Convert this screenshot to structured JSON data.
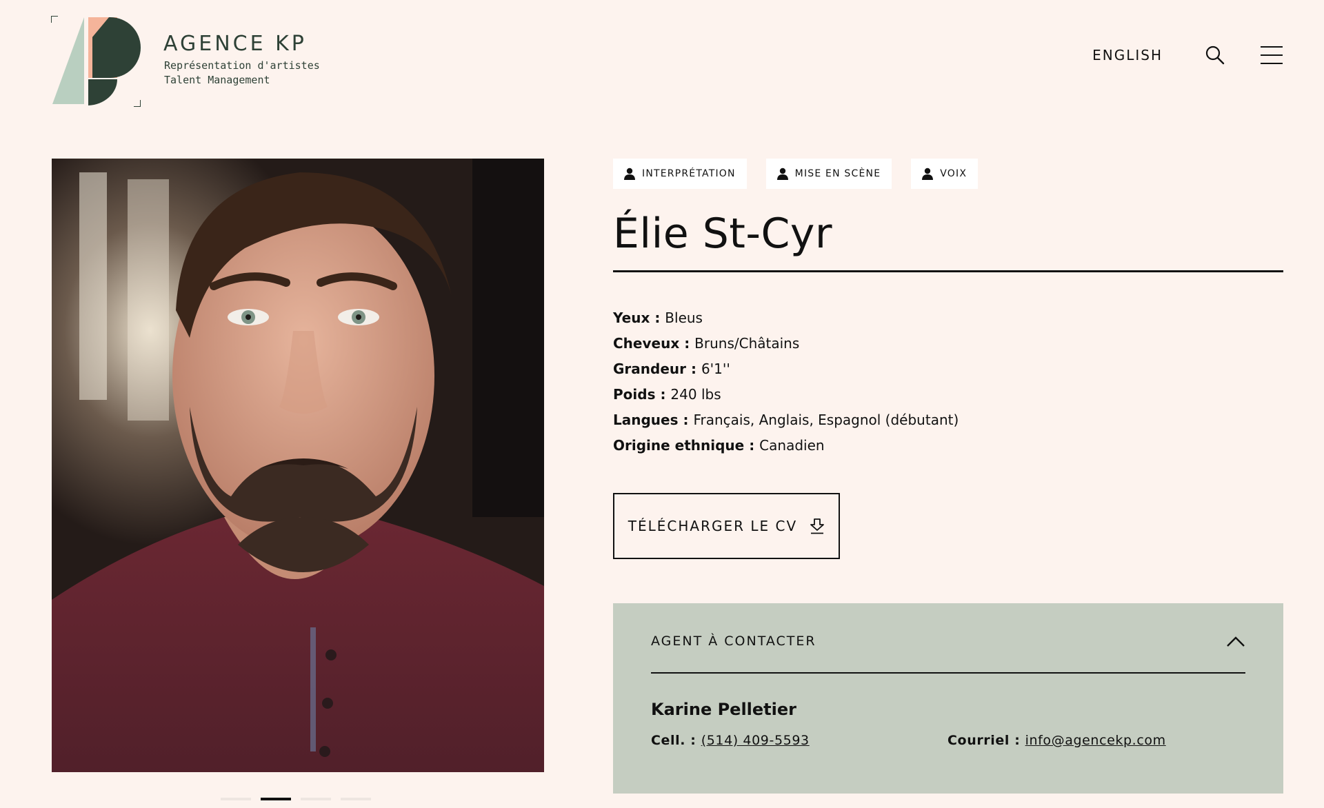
{
  "header": {
    "brand_name": "AGENCE KP",
    "brand_sub_1": "Représentation d'artistes",
    "brand_sub_2": "Talent Management",
    "lang_link": "ENGLISH",
    "colors": {
      "dark_green": "#2e4136",
      "sage": "#b9cfc0",
      "peach": "#f5b49a",
      "background": "#fdf3ee"
    }
  },
  "tags": [
    {
      "label": "INTERPRÉTATION",
      "icon": "person-icon"
    },
    {
      "label": "MISE EN SCÈNE",
      "icon": "person-icon"
    },
    {
      "label": "VOIX",
      "icon": "person-icon"
    }
  ],
  "profile": {
    "name": "Élie St-Cyr",
    "attributes": [
      {
        "label": "Yeux",
        "value": "Bleus"
      },
      {
        "label": "Cheveux",
        "value": "Bruns/Châtains"
      },
      {
        "label": "Grandeur",
        "value": "6'1''"
      },
      {
        "label": "Poids",
        "value": "240 lbs"
      },
      {
        "label": "Langues",
        "value": "Français, Anglais, Espagnol (débutant)"
      },
      {
        "label": "Origine ethnique",
        "value": "Canadien"
      }
    ],
    "separator": " : "
  },
  "cv_button": {
    "label": "TÉLÉCHARGER LE CV",
    "icon": "download-icon"
  },
  "agent": {
    "title": "AGENT À CONTACTER",
    "name": "Karine Pelletier",
    "phone_label": "Cell. : ",
    "phone": "(514) 409-5593",
    "email_label": "Courriel : ",
    "email": "info@agencekp.com",
    "panel_color": "#c5cdc1"
  },
  "carousel": {
    "count": 4,
    "active_index": 1
  }
}
